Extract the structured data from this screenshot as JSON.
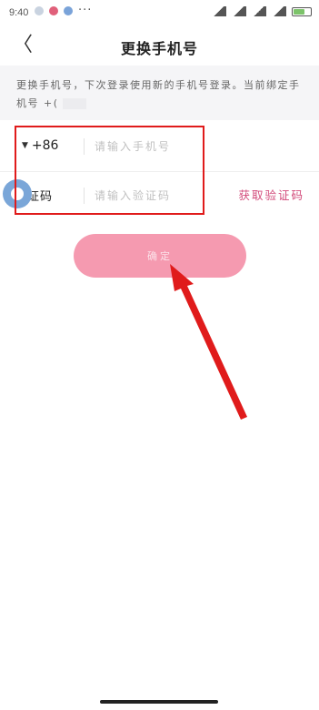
{
  "status_bar": {
    "time": "9:40",
    "more": "···"
  },
  "nav": {
    "title": "更换手机号",
    "back_glyph": "〈"
  },
  "notice": {
    "text": "更换手机号，下次登录使用新的手机号登录。当前绑定手机号 +("
  },
  "form": {
    "country_code": "+86",
    "phone_placeholder": "请输入手机号",
    "code_label": "证码",
    "code_placeholder": "请输入验证码",
    "get_code": "获取验证码"
  },
  "confirm_button": {
    "label": "确定"
  },
  "colors": {
    "accent": "#d24a7a",
    "button": "#f59ab0",
    "annotation": "#e01b1b"
  }
}
